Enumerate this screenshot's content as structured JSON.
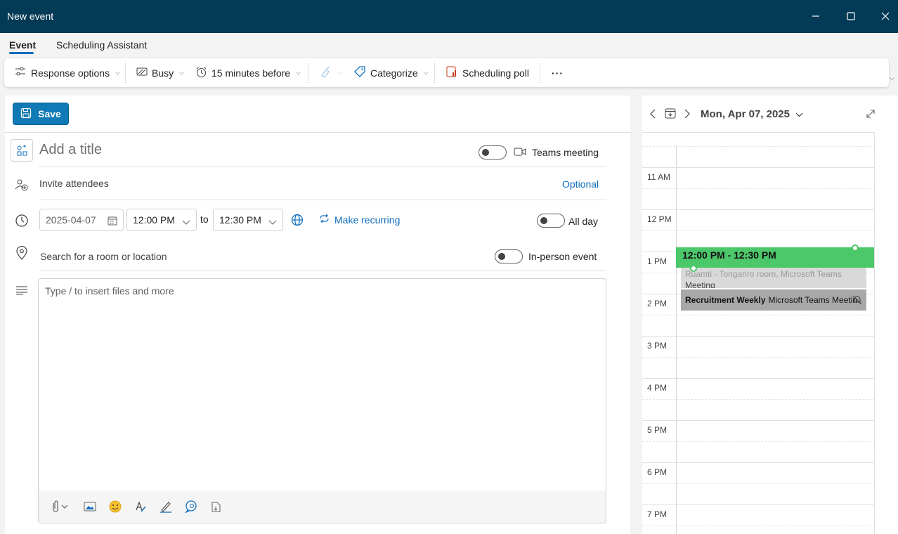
{
  "window": {
    "title": "New event"
  },
  "tabs": [
    {
      "label": "Event",
      "active": true
    },
    {
      "label": "Scheduling Assistant",
      "active": false
    }
  ],
  "toolbar": {
    "response_options": "Response options",
    "busy": "Busy",
    "reminder": "15 minutes before",
    "categorize": "Categorize",
    "scheduling_poll": "Scheduling poll",
    "more": "···"
  },
  "form": {
    "save_label": "Save",
    "title_placeholder": "Add a title",
    "teams_meeting_label": "Teams meeting",
    "invite_placeholder": "Invite attendees",
    "optional_label": "Optional",
    "start_date": "2025-04-07",
    "start_time": "12:00 PM",
    "to_label": "to",
    "end_time": "12:30 PM",
    "make_recurring": "Make recurring",
    "all_day_label": "All day",
    "location_placeholder": "Search for a room or location",
    "in_person_label": "In-person event",
    "body_placeholder": "Type / to insert files and more"
  },
  "calendar": {
    "date_label": "Mon, Apr 07, 2025",
    "hours": [
      "11 AM",
      "12 PM",
      "1 PM",
      "2 PM",
      "3 PM",
      "4 PM",
      "5 PM",
      "6 PM",
      "7 PM"
    ],
    "new_event": {
      "time_range": "12:00 PM - 12:30 PM"
    },
    "ghost_event": {
      "line1": "Ruamti - Tongariro room, Microsoft Teams",
      "line2": "Meeting"
    },
    "recurring_event": {
      "title": "Recruitment Weekly",
      "subtitle": "Microsoft Teams Meetin"
    }
  },
  "colors": {
    "titlebar": "#033a55",
    "accent": "#0f6cbd",
    "save": "#0f7ab5",
    "new_event": "#4cc76a"
  }
}
